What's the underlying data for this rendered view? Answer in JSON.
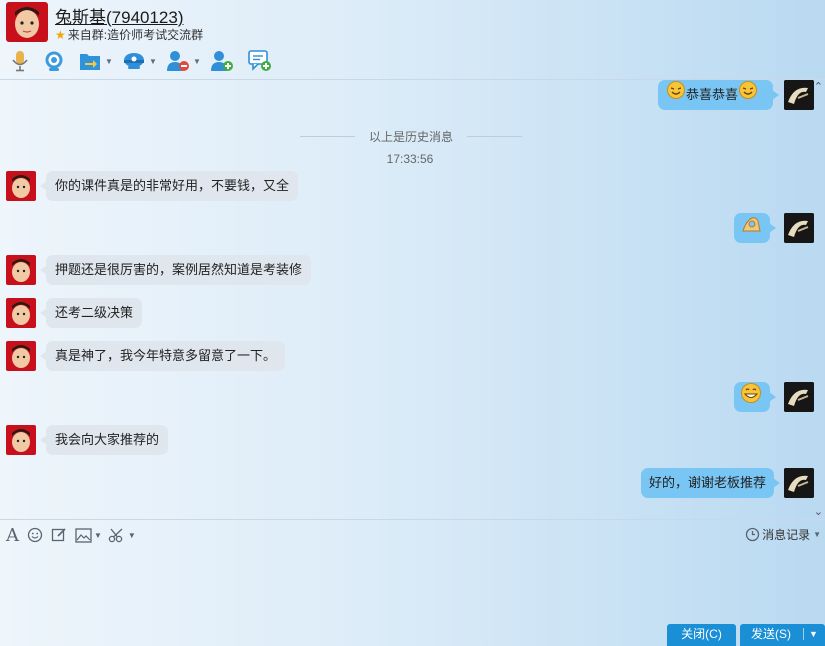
{
  "header": {
    "contact_name": "兔斯基(7940123)",
    "from_prefix": "来自群:",
    "group_name": "造价师考试交流群"
  },
  "toolbar": {
    "icons": [
      "microphone-icon",
      "video-camera-icon",
      "folder-transfer-icon",
      "remote-assist-icon",
      "block-user-icon",
      "add-friend-icon",
      "new-message-icon"
    ]
  },
  "chat": {
    "history_divider": "以上是历史消息",
    "timestamp": "17:33:56",
    "messages": [
      {
        "side": "right",
        "text": "恭喜恭喜",
        "emoji_before": "congrats-emoji",
        "emoji_after": "congrats-emoji"
      },
      {
        "side": "left",
        "text": "你的课件真是的非常好用，不要钱，又全"
      },
      {
        "side": "right",
        "text": "",
        "emoji": "ok-hand-emoji"
      },
      {
        "side": "left",
        "text": "押题还是很厉害的，案例居然知道是考装修"
      },
      {
        "side": "left",
        "text": "还考二级决策"
      },
      {
        "side": "left",
        "text": "真是神了，我今年特意多留意了一下。"
      },
      {
        "side": "right",
        "text": "",
        "emoji": "grin-emoji"
      },
      {
        "side": "left",
        "text": "我会向大家推荐的"
      },
      {
        "side": "right",
        "text": "好的，谢谢老板推荐"
      }
    ]
  },
  "editor": {
    "tools": [
      "font-icon",
      "emoji-icon",
      "edit-icon",
      "image-icon",
      "scissors-icon"
    ],
    "message_log_label": "消息记录"
  },
  "buttons": {
    "close_label": "关闭(C)",
    "send_label": "发送(S)"
  },
  "colors": {
    "accent": "#1a8fd6",
    "bubble_self": "#79c6f4",
    "bubble_other": "#dfe6ee"
  }
}
